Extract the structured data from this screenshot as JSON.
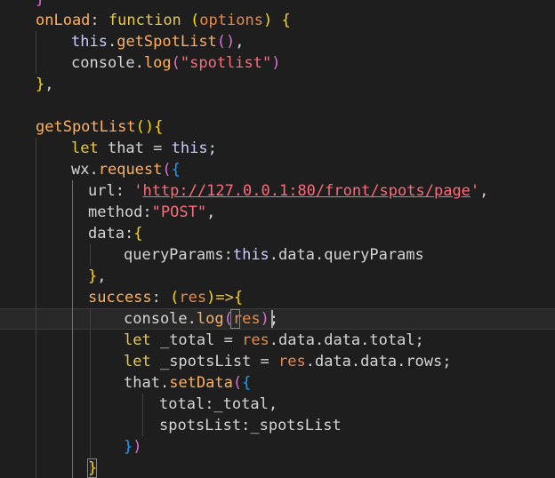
{
  "code_lines": [
    "    }",
    "onLoad: function (options) {",
    "    this.getSpotList(),",
    "    console.log(\"spotlist\")",
    "},",
    "",
    "getSpotList(){",
    "    let that = this;",
    "    wx.request({",
    "      url: 'http://127.0.0.1:80/front/spots/page',",
    "      method:\"POST\",",
    "      data:{",
    "          queryParams:this.data.queryParams",
    "      },",
    "      success: (res)=>{",
    "          console.log(res);",
    "          let _total = res.data.data.total;",
    "          let _spotsList = res.data.data.rows;",
    "          that.setData({",
    "              total:_total,",
    "              spotsList:_spotsList",
    "          })",
    "      }"
  ],
  "colors": {
    "background": "#1e1e1e",
    "function_name": "#ffaf5f",
    "keyword": "#e6c84c",
    "string": "#ff6a7a",
    "parameter": "#e68a4c",
    "bracket_level_1": "#ffd700",
    "bracket_level_2": "#da70d6",
    "bracket_level_3": "#179fff",
    "current_line": "#282828"
  }
}
